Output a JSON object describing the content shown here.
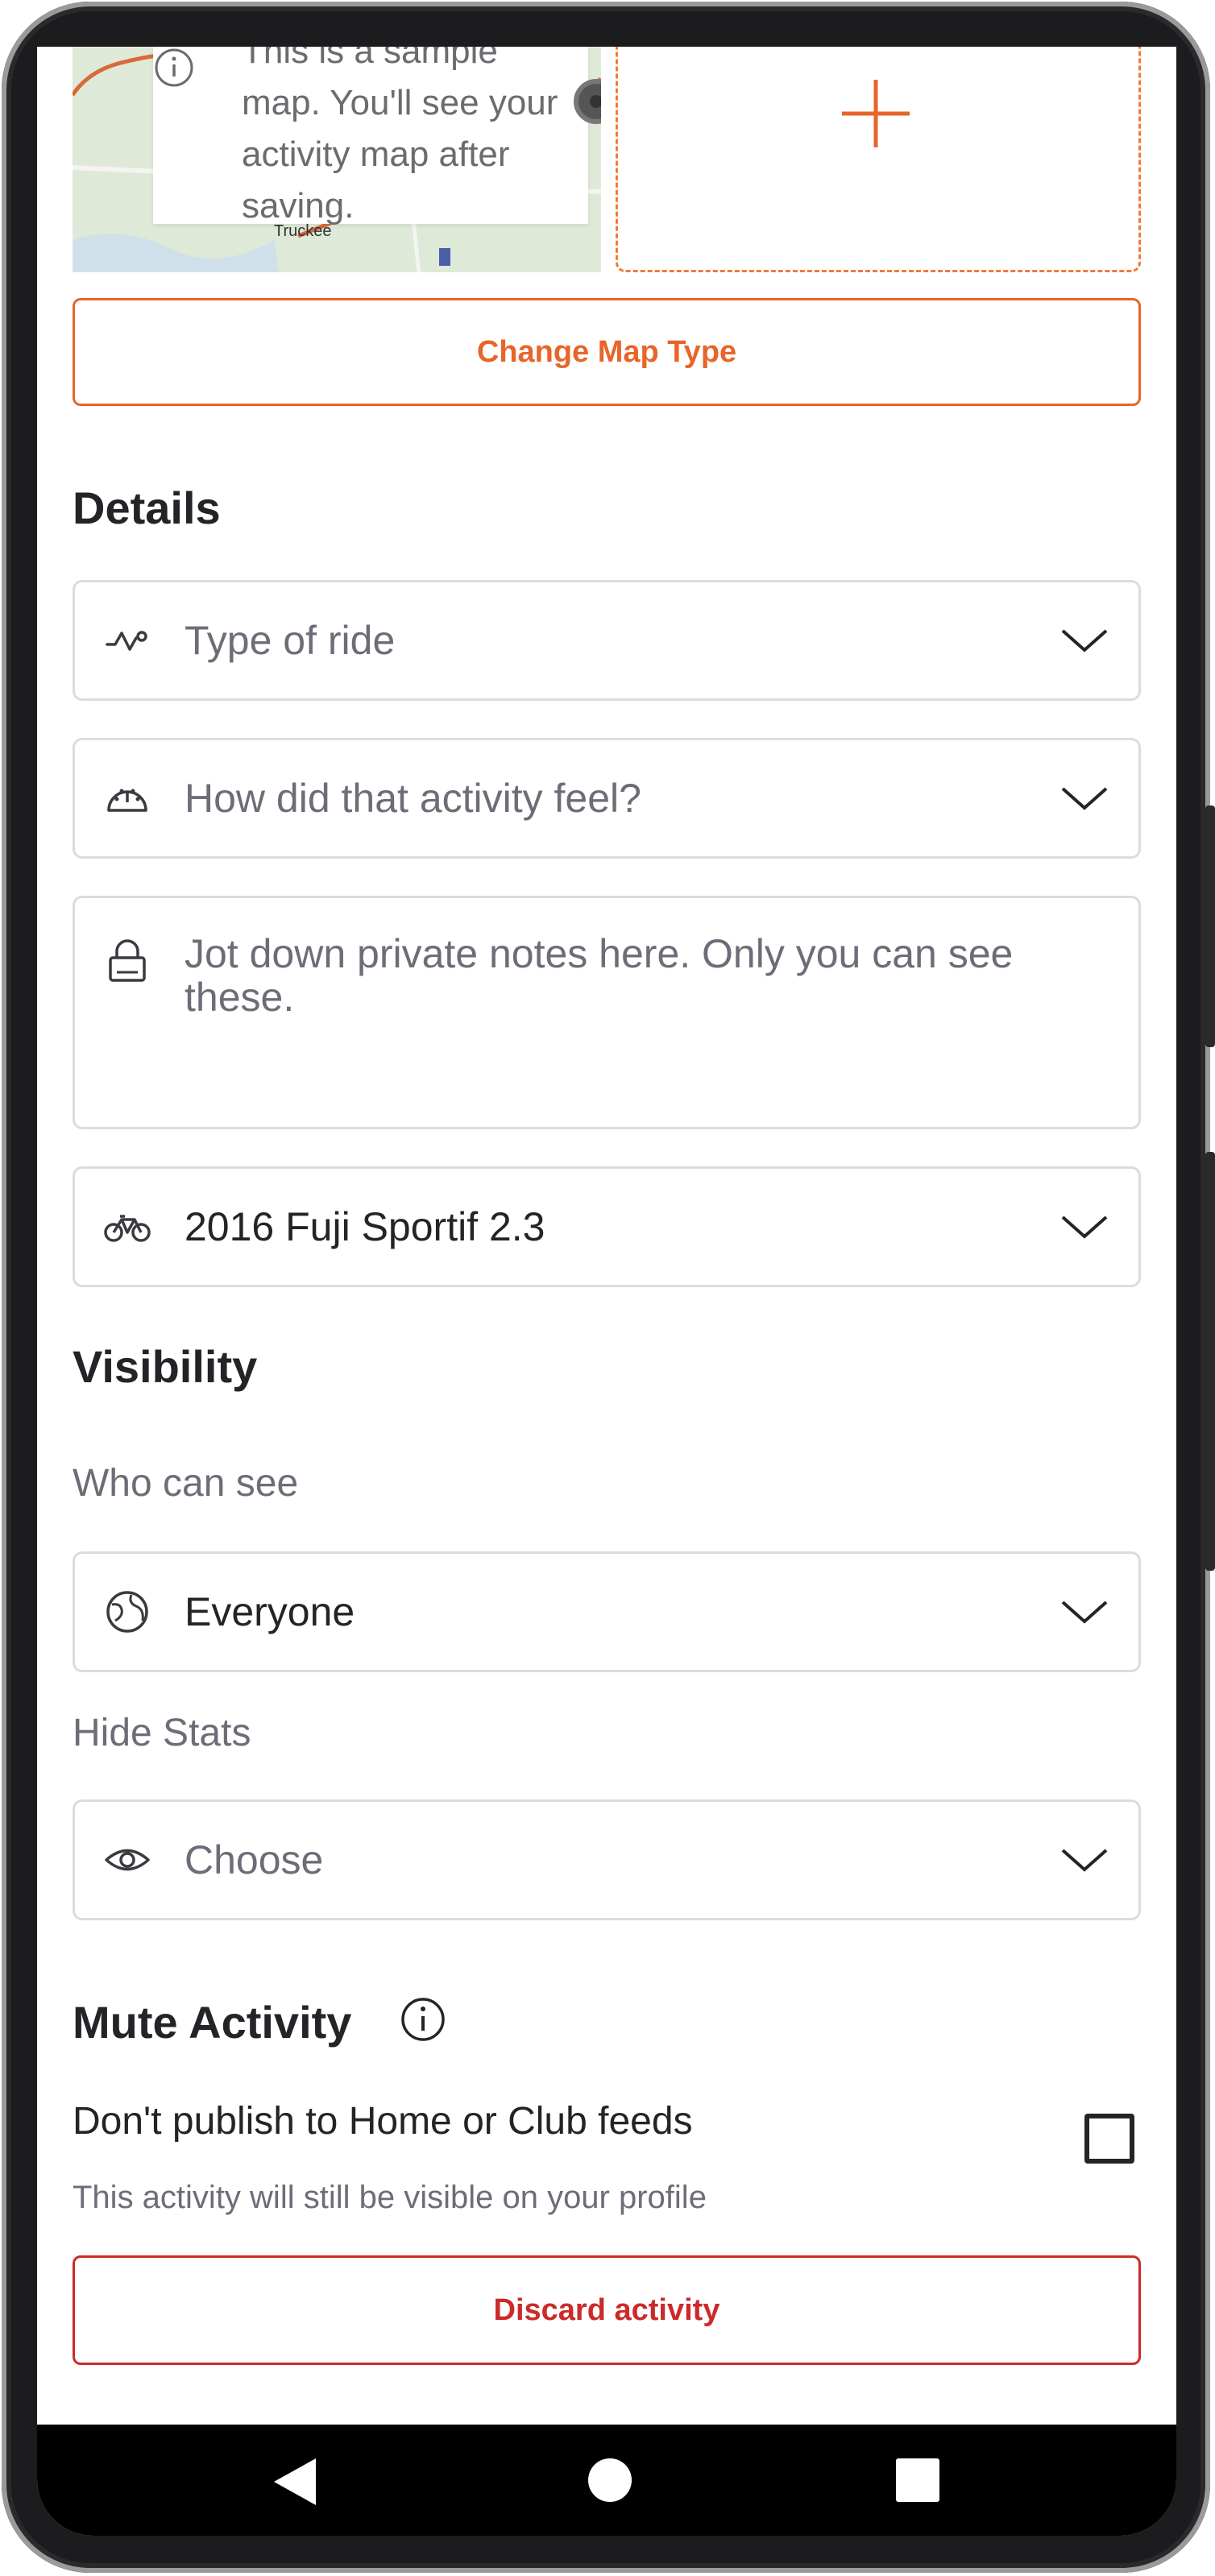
{
  "map": {
    "info_text": "This is a sample map. You'll see your activity map after saving.",
    "town_label": "Truckee"
  },
  "change_map_type_label": "Change Map Type",
  "details": {
    "title": "Details",
    "ride_type_placeholder": "Type of ride",
    "feel_placeholder": "How did that activity feel?",
    "notes_placeholder": "Jot down private notes here. Only you can see these.",
    "gear_value": "2016 Fuji Sportif 2.3"
  },
  "visibility": {
    "title": "Visibility",
    "who_can_see_label": "Who can see",
    "who_can_see_value": "Everyone",
    "hide_stats_label": "Hide Stats",
    "hide_stats_placeholder": "Choose"
  },
  "mute": {
    "title": "Mute Activity",
    "option_label": "Don't publish to Home or Club feeds",
    "option_sub": "This activity will still be visible on your profile",
    "checked": false
  },
  "discard_label": "Discard activity",
  "colors": {
    "accent": "#e8652a",
    "danger": "#cc2a2a",
    "text_primary": "#242428",
    "text_secondary": "#6d6d78",
    "border": "#dcdce0"
  }
}
